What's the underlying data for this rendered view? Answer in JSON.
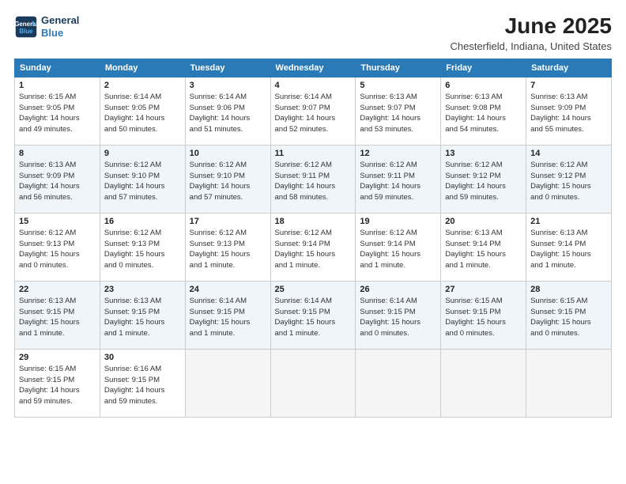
{
  "header": {
    "logo_line1": "General",
    "logo_line2": "Blue",
    "month_title": "June 2025",
    "location": "Chesterfield, Indiana, United States"
  },
  "weekdays": [
    "Sunday",
    "Monday",
    "Tuesday",
    "Wednesday",
    "Thursday",
    "Friday",
    "Saturday"
  ],
  "weeks": [
    [
      {
        "day": "1",
        "info": "Sunrise: 6:15 AM\nSunset: 9:05 PM\nDaylight: 14 hours\nand 49 minutes."
      },
      {
        "day": "2",
        "info": "Sunrise: 6:14 AM\nSunset: 9:05 PM\nDaylight: 14 hours\nand 50 minutes."
      },
      {
        "day": "3",
        "info": "Sunrise: 6:14 AM\nSunset: 9:06 PM\nDaylight: 14 hours\nand 51 minutes."
      },
      {
        "day": "4",
        "info": "Sunrise: 6:14 AM\nSunset: 9:07 PM\nDaylight: 14 hours\nand 52 minutes."
      },
      {
        "day": "5",
        "info": "Sunrise: 6:13 AM\nSunset: 9:07 PM\nDaylight: 14 hours\nand 53 minutes."
      },
      {
        "day": "6",
        "info": "Sunrise: 6:13 AM\nSunset: 9:08 PM\nDaylight: 14 hours\nand 54 minutes."
      },
      {
        "day": "7",
        "info": "Sunrise: 6:13 AM\nSunset: 9:09 PM\nDaylight: 14 hours\nand 55 minutes."
      }
    ],
    [
      {
        "day": "8",
        "info": "Sunrise: 6:13 AM\nSunset: 9:09 PM\nDaylight: 14 hours\nand 56 minutes."
      },
      {
        "day": "9",
        "info": "Sunrise: 6:12 AM\nSunset: 9:10 PM\nDaylight: 14 hours\nand 57 minutes."
      },
      {
        "day": "10",
        "info": "Sunrise: 6:12 AM\nSunset: 9:10 PM\nDaylight: 14 hours\nand 57 minutes."
      },
      {
        "day": "11",
        "info": "Sunrise: 6:12 AM\nSunset: 9:11 PM\nDaylight: 14 hours\nand 58 minutes."
      },
      {
        "day": "12",
        "info": "Sunrise: 6:12 AM\nSunset: 9:11 PM\nDaylight: 14 hours\nand 59 minutes."
      },
      {
        "day": "13",
        "info": "Sunrise: 6:12 AM\nSunset: 9:12 PM\nDaylight: 14 hours\nand 59 minutes."
      },
      {
        "day": "14",
        "info": "Sunrise: 6:12 AM\nSunset: 9:12 PM\nDaylight: 15 hours\nand 0 minutes."
      }
    ],
    [
      {
        "day": "15",
        "info": "Sunrise: 6:12 AM\nSunset: 9:13 PM\nDaylight: 15 hours\nand 0 minutes."
      },
      {
        "day": "16",
        "info": "Sunrise: 6:12 AM\nSunset: 9:13 PM\nDaylight: 15 hours\nand 0 minutes."
      },
      {
        "day": "17",
        "info": "Sunrise: 6:12 AM\nSunset: 9:13 PM\nDaylight: 15 hours\nand 1 minute."
      },
      {
        "day": "18",
        "info": "Sunrise: 6:12 AM\nSunset: 9:14 PM\nDaylight: 15 hours\nand 1 minute."
      },
      {
        "day": "19",
        "info": "Sunrise: 6:12 AM\nSunset: 9:14 PM\nDaylight: 15 hours\nand 1 minute."
      },
      {
        "day": "20",
        "info": "Sunrise: 6:13 AM\nSunset: 9:14 PM\nDaylight: 15 hours\nand 1 minute."
      },
      {
        "day": "21",
        "info": "Sunrise: 6:13 AM\nSunset: 9:14 PM\nDaylight: 15 hours\nand 1 minute."
      }
    ],
    [
      {
        "day": "22",
        "info": "Sunrise: 6:13 AM\nSunset: 9:15 PM\nDaylight: 15 hours\nand 1 minute."
      },
      {
        "day": "23",
        "info": "Sunrise: 6:13 AM\nSunset: 9:15 PM\nDaylight: 15 hours\nand 1 minute."
      },
      {
        "day": "24",
        "info": "Sunrise: 6:14 AM\nSunset: 9:15 PM\nDaylight: 15 hours\nand 1 minute."
      },
      {
        "day": "25",
        "info": "Sunrise: 6:14 AM\nSunset: 9:15 PM\nDaylight: 15 hours\nand 1 minute."
      },
      {
        "day": "26",
        "info": "Sunrise: 6:14 AM\nSunset: 9:15 PM\nDaylight: 15 hours\nand 0 minutes."
      },
      {
        "day": "27",
        "info": "Sunrise: 6:15 AM\nSunset: 9:15 PM\nDaylight: 15 hours\nand 0 minutes."
      },
      {
        "day": "28",
        "info": "Sunrise: 6:15 AM\nSunset: 9:15 PM\nDaylight: 15 hours\nand 0 minutes."
      }
    ],
    [
      {
        "day": "29",
        "info": "Sunrise: 6:15 AM\nSunset: 9:15 PM\nDaylight: 14 hours\nand 59 minutes."
      },
      {
        "day": "30",
        "info": "Sunrise: 6:16 AM\nSunset: 9:15 PM\nDaylight: 14 hours\nand 59 minutes."
      },
      {
        "day": "",
        "info": ""
      },
      {
        "day": "",
        "info": ""
      },
      {
        "day": "",
        "info": ""
      },
      {
        "day": "",
        "info": ""
      },
      {
        "day": "",
        "info": ""
      }
    ]
  ]
}
